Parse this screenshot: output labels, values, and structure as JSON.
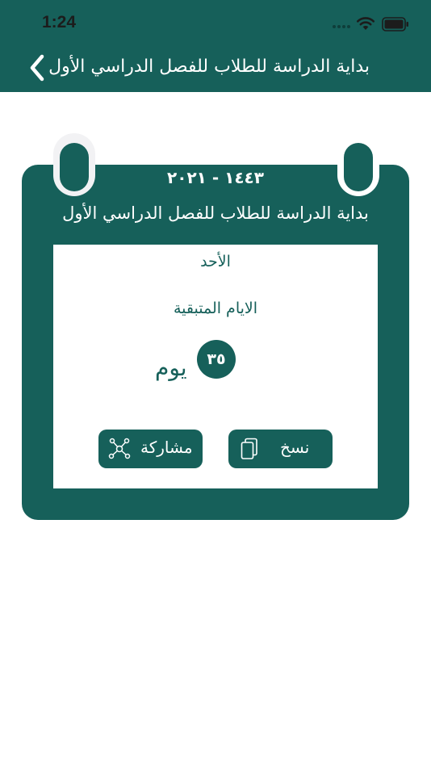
{
  "status_bar": {
    "time": "1:24"
  },
  "nav": {
    "title": "بداية الدراسة للطلاب للفصل الدراسي الأول",
    "back_icon": "chevron-left-icon"
  },
  "card": {
    "years": "١٤٤٣ - ٢٠٢١",
    "title": "بداية الدراسة للطلاب للفصل الدراسي الأول",
    "day_name": "الأحد",
    "remaining_label": "الايام المتبقية",
    "count": "٣٥",
    "unit": "يوم"
  },
  "actions": {
    "copy_label": "نسخ",
    "share_label": "مشاركة",
    "copy_icon": "copy-icon",
    "share_icon": "share-network-icon"
  },
  "colors": {
    "primary": "#16605a",
    "background": "#ffffff",
    "ring_left": "#f2f2f4"
  }
}
